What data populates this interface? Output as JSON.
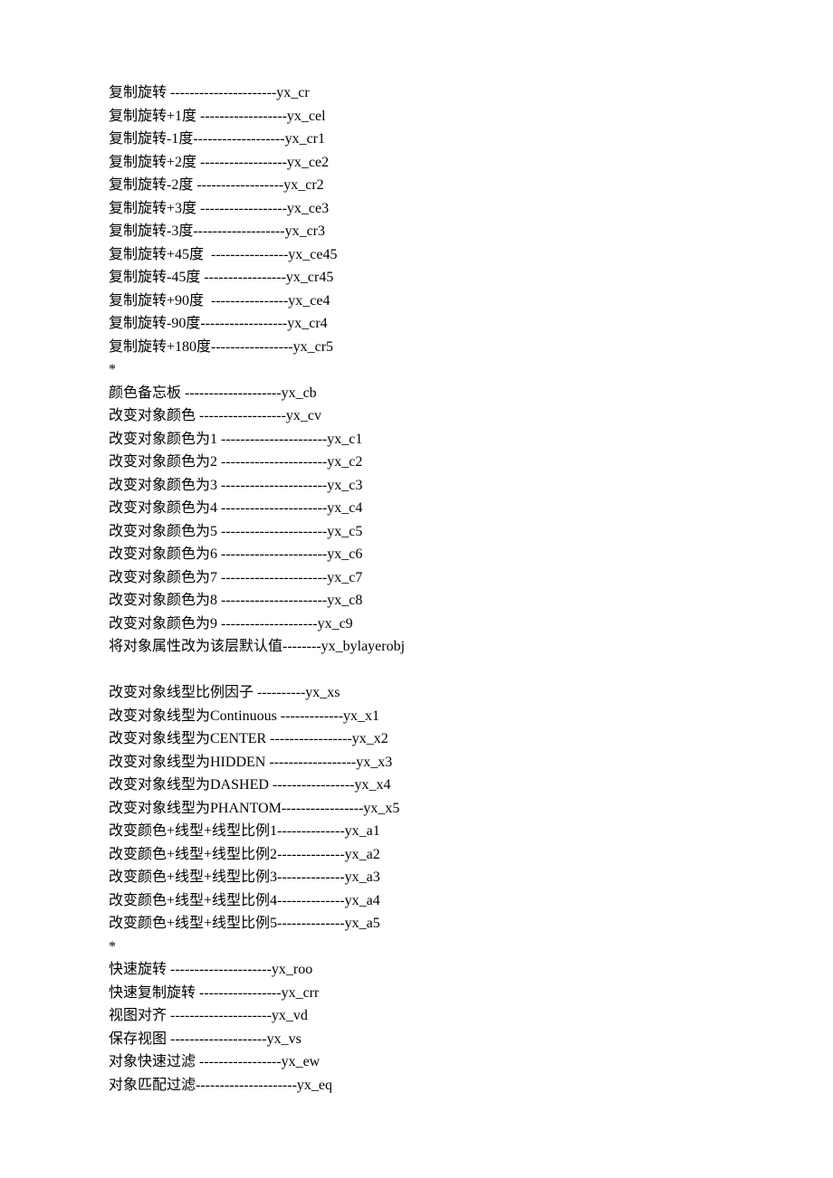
{
  "lines": [
    "复制旋转 ----------------------yx_cr",
    "复制旋转+1度 ------------------yx_cel",
    "复制旋转-1度-------------------yx_cr1",
    "复制旋转+2度 ------------------yx_ce2",
    "复制旋转-2度 ------------------yx_cr2",
    "复制旋转+3度 ------------------yx_ce3",
    "复制旋转-3度-------------------yx_cr3",
    "复制旋转+45度  ----------------yx_ce45",
    "复制旋转-45度 -----------------yx_cr45",
    "复制旋转+90度  ----------------yx_ce4",
    "复制旋转-90度------------------yx_cr4",
    "复制旋转+180度-----------------yx_cr5",
    "*",
    "颜色备忘板 --------------------yx_cb",
    "改变对象颜色 ------------------yx_cv",
    "改变对象颜色为1 ----------------------yx_c1",
    "改变对象颜色为2 ----------------------yx_c2",
    "改变对象颜色为3 ----------------------yx_c3",
    "改变对象颜色为4 ----------------------yx_c4",
    "改变对象颜色为5 ----------------------yx_c5",
    "改变对象颜色为6 ----------------------yx_c6",
    "改变对象颜色为7 ----------------------yx_c7",
    "改变对象颜色为8 ----------------------yx_c8",
    "改变对象颜色为9 --------------------yx_c9",
    "将对象属性改为该层默认值--------yx_bylayerobj",
    "",
    "改变对象线型比例因子 ----------yx_xs",
    "改变对象线型为Continuous -------------yx_x1",
    "改变对象线型为CENTER -----------------yx_x2",
    "改变对象线型为HIDDEN ------------------yx_x3",
    "改变对象线型为DASHED -----------------yx_x4",
    "改变对象线型为PHANTOM-----------------yx_x5",
    "改变颜色+线型+线型比例1--------------yx_a1",
    "改变颜色+线型+线型比例2--------------yx_a2",
    "改变颜色+线型+线型比例3--------------yx_a3",
    "改变颜色+线型+线型比例4--------------yx_a4",
    "改变颜色+线型+线型比例5--------------yx_a5",
    "*",
    "快速旋转 ---------------------yx_roo",
    "快速复制旋转 -----------------yx_crr",
    "视图对齐 ---------------------yx_vd",
    "保存视图 --------------------yx_vs",
    "对象快速过滤 -----------------yx_ew",
    "对象匹配过滤---------------------yx_eq"
  ]
}
